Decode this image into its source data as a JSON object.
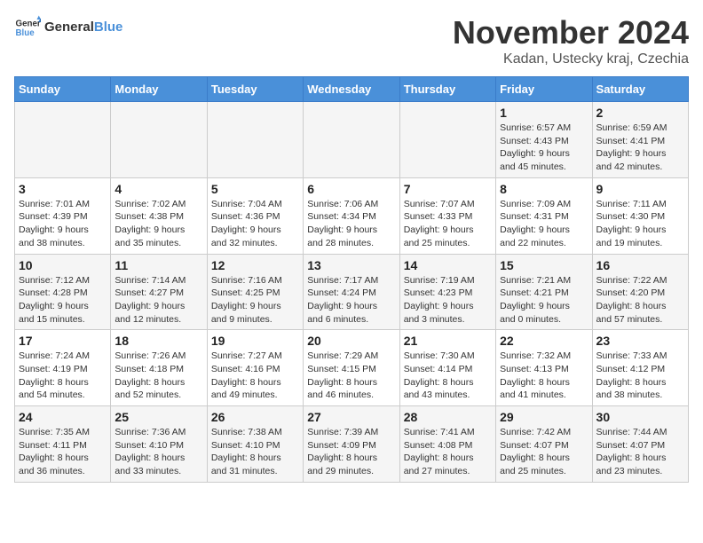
{
  "logo": {
    "text_general": "General",
    "text_blue": "Blue"
  },
  "header": {
    "title": "November 2024",
    "subtitle": "Kadan, Ustecky kraj, Czechia"
  },
  "weekdays": [
    "Sunday",
    "Monday",
    "Tuesday",
    "Wednesday",
    "Thursday",
    "Friday",
    "Saturday"
  ],
  "weeks": [
    [
      {
        "day": "",
        "info": ""
      },
      {
        "day": "",
        "info": ""
      },
      {
        "day": "",
        "info": ""
      },
      {
        "day": "",
        "info": ""
      },
      {
        "day": "",
        "info": ""
      },
      {
        "day": "1",
        "info": "Sunrise: 6:57 AM\nSunset: 4:43 PM\nDaylight: 9 hours\nand 45 minutes."
      },
      {
        "day": "2",
        "info": "Sunrise: 6:59 AM\nSunset: 4:41 PM\nDaylight: 9 hours\nand 42 minutes."
      }
    ],
    [
      {
        "day": "3",
        "info": "Sunrise: 7:01 AM\nSunset: 4:39 PM\nDaylight: 9 hours\nand 38 minutes."
      },
      {
        "day": "4",
        "info": "Sunrise: 7:02 AM\nSunset: 4:38 PM\nDaylight: 9 hours\nand 35 minutes."
      },
      {
        "day": "5",
        "info": "Sunrise: 7:04 AM\nSunset: 4:36 PM\nDaylight: 9 hours\nand 32 minutes."
      },
      {
        "day": "6",
        "info": "Sunrise: 7:06 AM\nSunset: 4:34 PM\nDaylight: 9 hours\nand 28 minutes."
      },
      {
        "day": "7",
        "info": "Sunrise: 7:07 AM\nSunset: 4:33 PM\nDaylight: 9 hours\nand 25 minutes."
      },
      {
        "day": "8",
        "info": "Sunrise: 7:09 AM\nSunset: 4:31 PM\nDaylight: 9 hours\nand 22 minutes."
      },
      {
        "day": "9",
        "info": "Sunrise: 7:11 AM\nSunset: 4:30 PM\nDaylight: 9 hours\nand 19 minutes."
      }
    ],
    [
      {
        "day": "10",
        "info": "Sunrise: 7:12 AM\nSunset: 4:28 PM\nDaylight: 9 hours\nand 15 minutes."
      },
      {
        "day": "11",
        "info": "Sunrise: 7:14 AM\nSunset: 4:27 PM\nDaylight: 9 hours\nand 12 minutes."
      },
      {
        "day": "12",
        "info": "Sunrise: 7:16 AM\nSunset: 4:25 PM\nDaylight: 9 hours\nand 9 minutes."
      },
      {
        "day": "13",
        "info": "Sunrise: 7:17 AM\nSunset: 4:24 PM\nDaylight: 9 hours\nand 6 minutes."
      },
      {
        "day": "14",
        "info": "Sunrise: 7:19 AM\nSunset: 4:23 PM\nDaylight: 9 hours\nand 3 minutes."
      },
      {
        "day": "15",
        "info": "Sunrise: 7:21 AM\nSunset: 4:21 PM\nDaylight: 9 hours\nand 0 minutes."
      },
      {
        "day": "16",
        "info": "Sunrise: 7:22 AM\nSunset: 4:20 PM\nDaylight: 8 hours\nand 57 minutes."
      }
    ],
    [
      {
        "day": "17",
        "info": "Sunrise: 7:24 AM\nSunset: 4:19 PM\nDaylight: 8 hours\nand 54 minutes."
      },
      {
        "day": "18",
        "info": "Sunrise: 7:26 AM\nSunset: 4:18 PM\nDaylight: 8 hours\nand 52 minutes."
      },
      {
        "day": "19",
        "info": "Sunrise: 7:27 AM\nSunset: 4:16 PM\nDaylight: 8 hours\nand 49 minutes."
      },
      {
        "day": "20",
        "info": "Sunrise: 7:29 AM\nSunset: 4:15 PM\nDaylight: 8 hours\nand 46 minutes."
      },
      {
        "day": "21",
        "info": "Sunrise: 7:30 AM\nSunset: 4:14 PM\nDaylight: 8 hours\nand 43 minutes."
      },
      {
        "day": "22",
        "info": "Sunrise: 7:32 AM\nSunset: 4:13 PM\nDaylight: 8 hours\nand 41 minutes."
      },
      {
        "day": "23",
        "info": "Sunrise: 7:33 AM\nSunset: 4:12 PM\nDaylight: 8 hours\nand 38 minutes."
      }
    ],
    [
      {
        "day": "24",
        "info": "Sunrise: 7:35 AM\nSunset: 4:11 PM\nDaylight: 8 hours\nand 36 minutes."
      },
      {
        "day": "25",
        "info": "Sunrise: 7:36 AM\nSunset: 4:10 PM\nDaylight: 8 hours\nand 33 minutes."
      },
      {
        "day": "26",
        "info": "Sunrise: 7:38 AM\nSunset: 4:10 PM\nDaylight: 8 hours\nand 31 minutes."
      },
      {
        "day": "27",
        "info": "Sunrise: 7:39 AM\nSunset: 4:09 PM\nDaylight: 8 hours\nand 29 minutes."
      },
      {
        "day": "28",
        "info": "Sunrise: 7:41 AM\nSunset: 4:08 PM\nDaylight: 8 hours\nand 27 minutes."
      },
      {
        "day": "29",
        "info": "Sunrise: 7:42 AM\nSunset: 4:07 PM\nDaylight: 8 hours\nand 25 minutes."
      },
      {
        "day": "30",
        "info": "Sunrise: 7:44 AM\nSunset: 4:07 PM\nDaylight: 8 hours\nand 23 minutes."
      }
    ]
  ]
}
